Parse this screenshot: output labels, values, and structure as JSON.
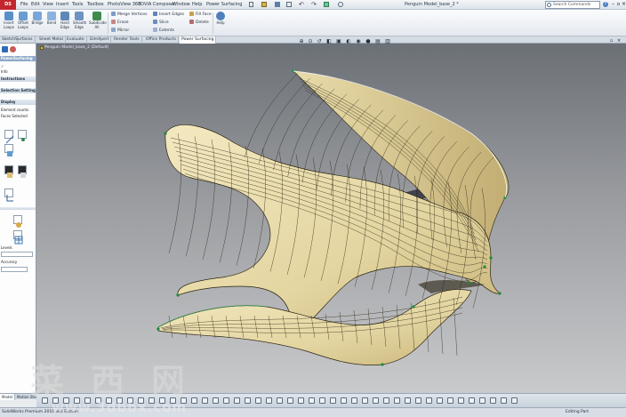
{
  "app": {
    "logo": "DS",
    "window_title": "Penguin Model_base_2 *"
  },
  "menu": [
    "File",
    "Edit",
    "View",
    "Insert",
    "Tools",
    "Toolbox",
    "PhotoView 360",
    "3DVIA Composer",
    "Window",
    "Help",
    "Power Surfacing"
  ],
  "search": {
    "placeholder": "Search Commands"
  },
  "ribbon": {
    "big_buttons": [
      {
        "label": "Insert\nLoops",
        "color": "#5a8fc8"
      },
      {
        "label": "Offset\nLoops",
        "color": "#6c9bd0"
      },
      {
        "label": "Bridge",
        "color": "#7aa7d8"
      },
      {
        "label": "Bend",
        "color": "#8cb3de"
      },
      {
        "label": "Hard\nEdge",
        "color": "#5f88b8"
      },
      {
        "label": "Smooth\nEdge",
        "color": "#6f93c2"
      },
      {
        "label": "Subdivide\nAll",
        "color": "#3f8b4f"
      }
    ],
    "small_col1": [
      "Merge Vertices",
      "Erase",
      "Mirror"
    ],
    "small_col2": [
      "Insert Edges",
      "Slice",
      "Extents"
    ],
    "small_col3": [
      "Fill Face",
      "Delete"
    ],
    "help_label": "Help"
  },
  "tabs": [
    "Sketch",
    "Surfaces",
    "Sheet Metal",
    "Evaluate",
    "DimXpert",
    "Render Tools",
    "Office Products",
    "Power Surfacing"
  ],
  "active_tab": "Power Surfacing",
  "left_panel": {
    "title": "PowerSurfacing",
    "sections": [
      {
        "header": "Instructions"
      },
      {
        "header": "Selection Settings"
      },
      {
        "header": "Display"
      }
    ],
    "texts": [
      "Info",
      "Element counts",
      "Faces Selected"
    ],
    "extra_texts": [
      "Levels",
      "Accuracy"
    ]
  },
  "viewport": {
    "tree_label": "Penguin Model_base_2 (Default)"
  },
  "bottom_tabs": [
    "Model",
    "Motion Study 1"
  ],
  "active_bottom_tab": "Model",
  "status": {
    "left": "SolidWorks Premium 2010 x64 Edition",
    "right": "Editing Part"
  },
  "watermark": {
    "chinese": "菜西网",
    "url": "www.3dbbx.com"
  },
  "colors": {
    "surface": "#e8dcae",
    "surface_shade": "#cdbb82",
    "mesh_line": "#2b2410",
    "vertex": "#1e8a3a",
    "accent": "#c4262e"
  }
}
